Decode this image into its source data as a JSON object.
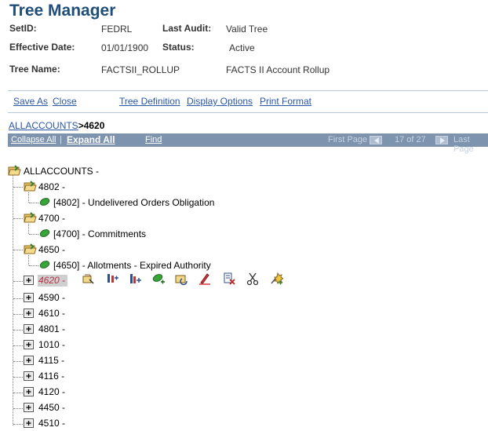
{
  "header": {
    "title": "Tree Manager",
    "setid_label": "SetID:",
    "setid_value": "FEDRL",
    "last_audit_label": "Last Audit:",
    "last_audit_value": "Valid Tree",
    "effdate_label": "Effective Date:",
    "effdate_value": "01/01/1900",
    "status_label": "Status:",
    "status_value": "Active",
    "treename_label": "Tree Name:",
    "treename_value": "FACTSII_ROLLUP",
    "tree_desc": "FACTS II Account Rollup"
  },
  "toolbar": {
    "save_as": "Save As",
    "close": "Close",
    "tree_definition": "Tree Definition",
    "display_options": "Display Options",
    "print_format": "Print Format"
  },
  "breadcrumb": {
    "root": "ALLACCOUNTS",
    "current": ">4620"
  },
  "navbar": {
    "collapse_all": "Collapse All",
    "separator": "|",
    "expand_all": "Expand All",
    "find": "Find",
    "first_page": "First Page",
    "page_info": "17 of 27",
    "last_page": "Last Page"
  },
  "tree": {
    "root": "ALLACCOUNTS -",
    "nodes": [
      {
        "label": "4802 -",
        "child": "[4802] - Undelivered Orders Obligation"
      },
      {
        "label": "4700 -",
        "child": "[4700] - Commitments"
      },
      {
        "label": "4650 -",
        "child": "[4650] - Allotments - Expired Authority"
      }
    ],
    "selected": "4620 -",
    "collapsed": [
      "4590 -",
      "4610 -",
      "4801 -",
      "1010 -",
      "4115 -",
      "4116 -",
      "4120 -",
      "4450 -",
      "4510 -"
    ]
  },
  "node_actions": [
    "edit-data-icon",
    "insert-sibling-icon",
    "insert-child-icon",
    "insert-detail-icon",
    "cut-paste-icon",
    "edit-node-icon",
    "delete-icon",
    "cut-icon",
    "move-icon"
  ]
}
